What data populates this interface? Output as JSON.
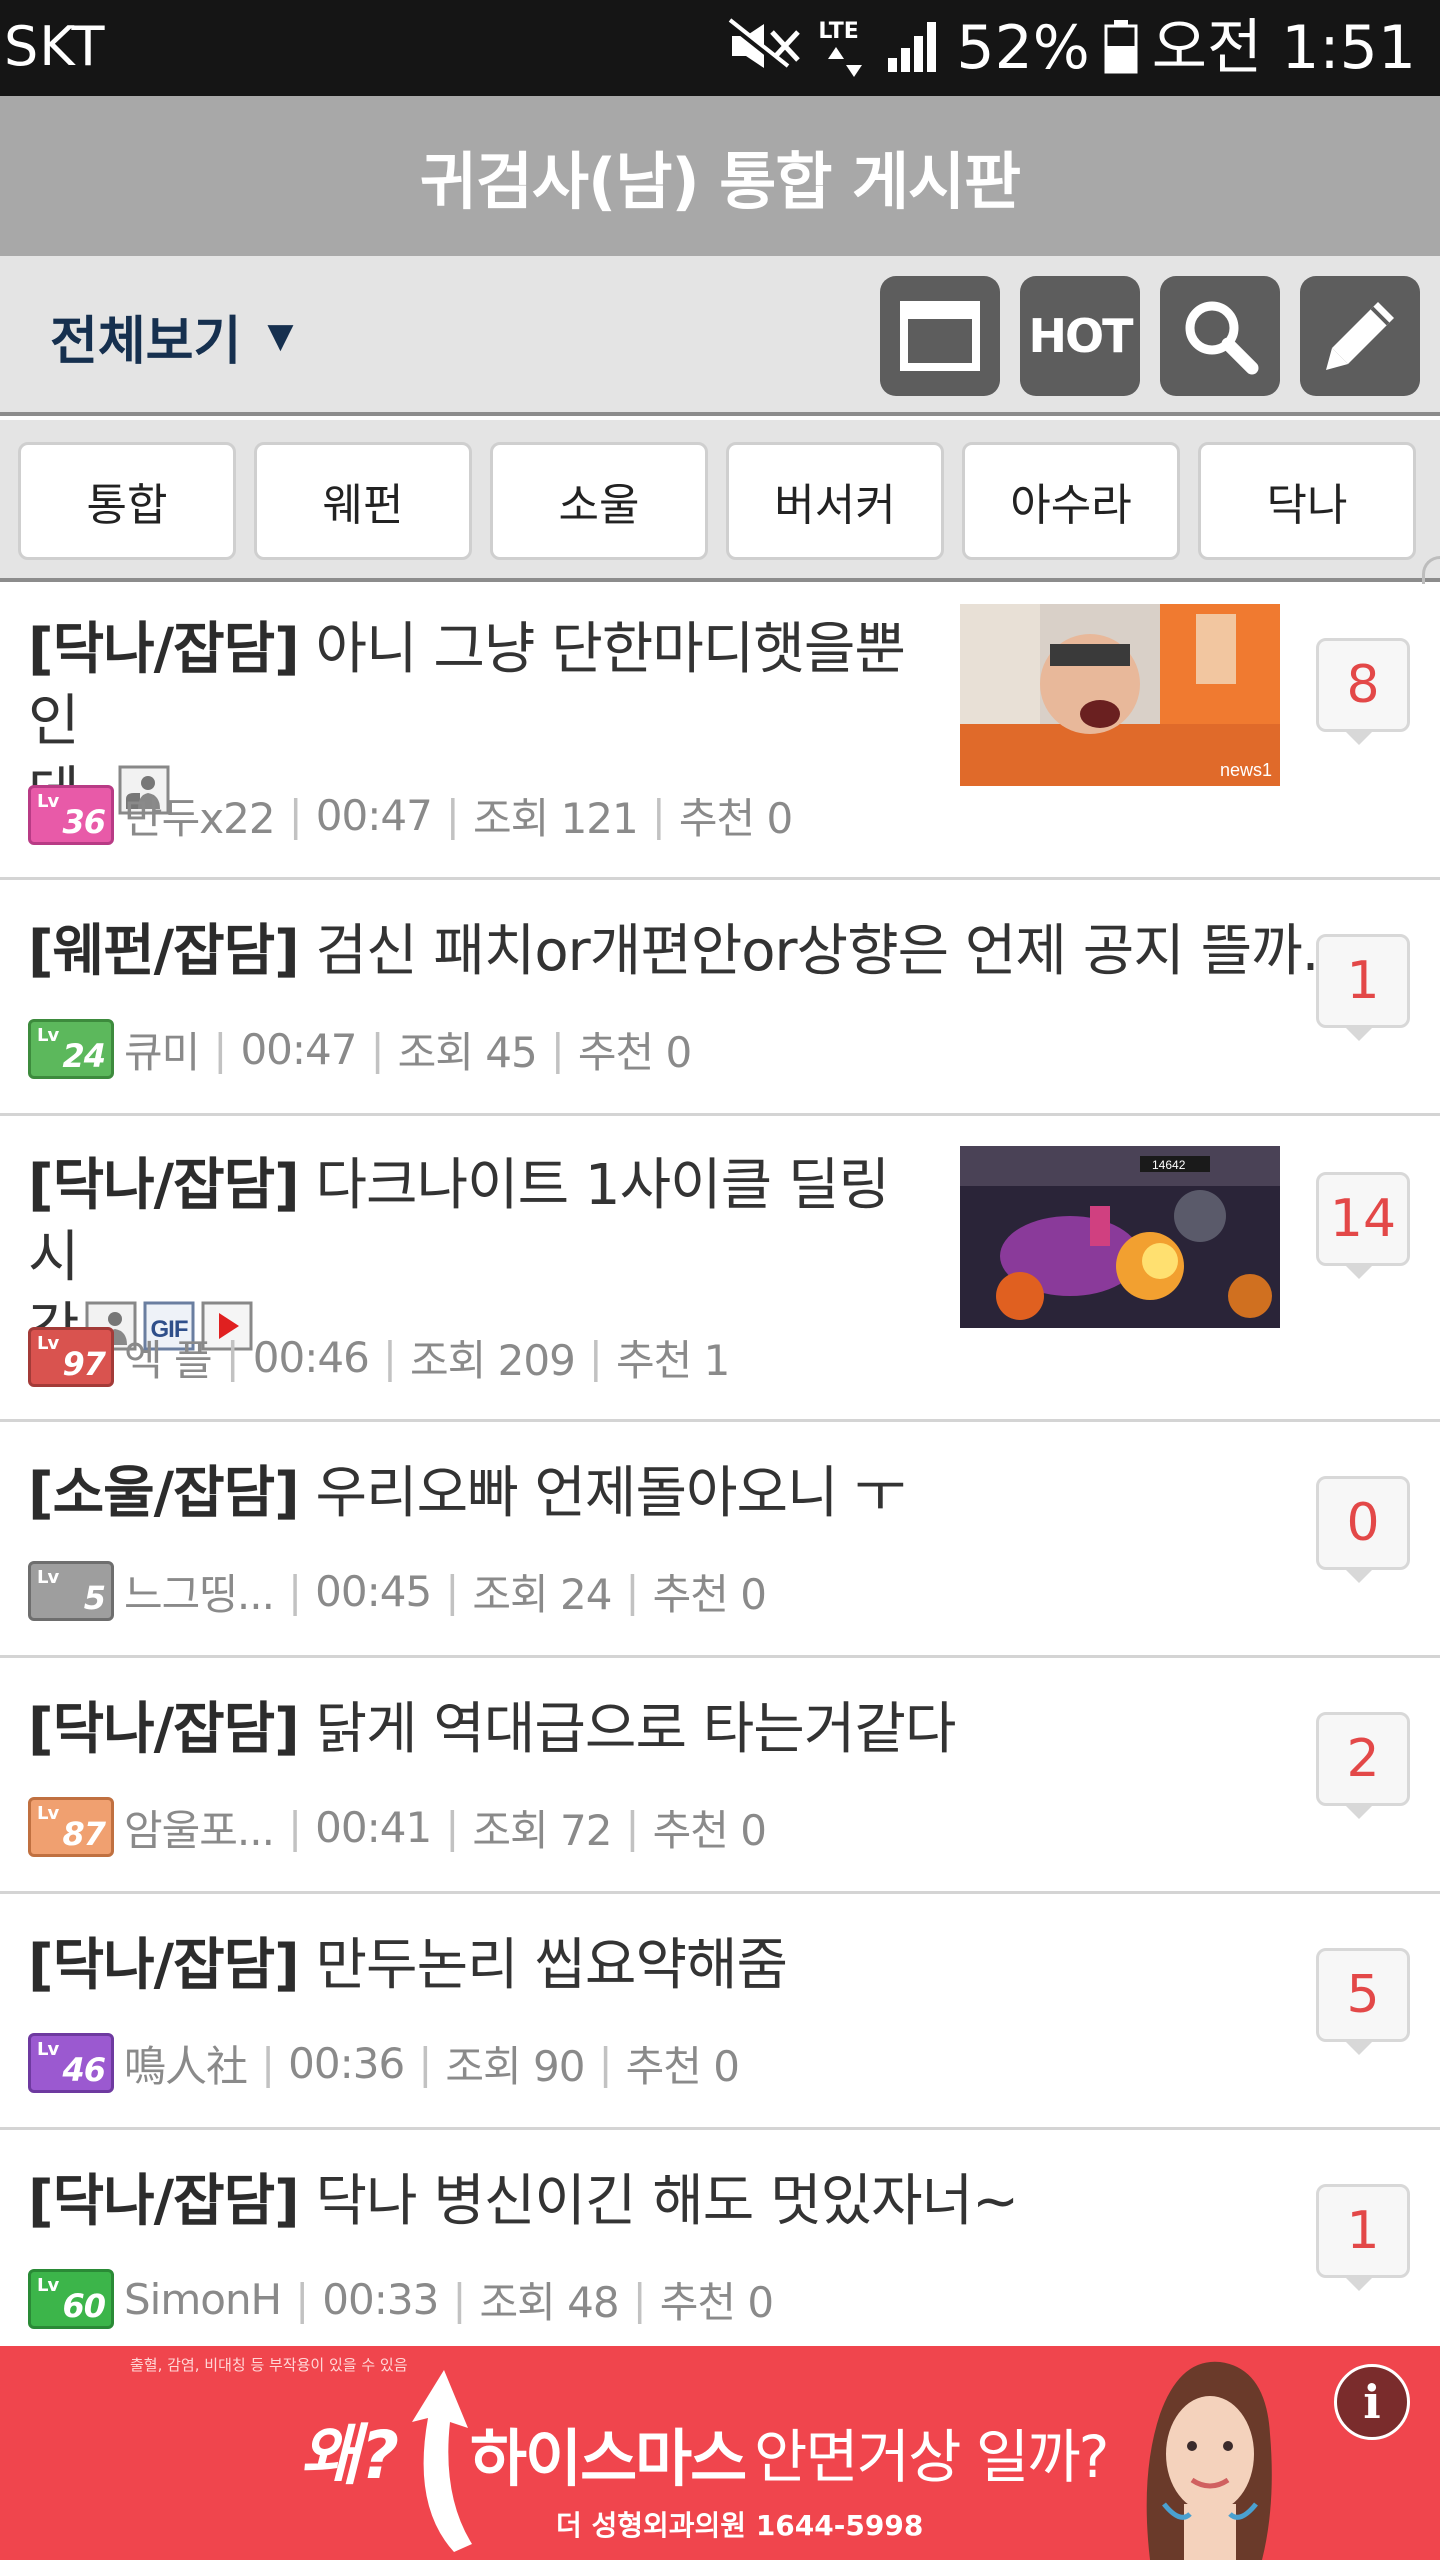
{
  "statusbar": {
    "carrier": "SKT",
    "network": "LTE",
    "battery": "52%",
    "time": "오전 1:51"
  },
  "header": {
    "title": "귀검사(남) 통합 게시판"
  },
  "toolbar": {
    "view_label": "전체보기",
    "view_caret": "▼",
    "hot_label": "HOT",
    "icons": [
      "window-icon",
      "hot-icon",
      "search-icon",
      "pencil-icon"
    ]
  },
  "tabs": [
    "통합",
    "웨펀",
    "소울",
    "버서커",
    "아수라",
    "닥나"
  ],
  "posts": [
    {
      "category": "[닥나/잡담]",
      "title_l1": " 아니 그냥 단한마디햇을뿐인",
      "title_l2": "데..",
      "level": "36",
      "level_color": "#e85aa8",
      "author": "만두x22",
      "time": "00:47",
      "views": "조회 121",
      "recommends": "추천 0",
      "comments": "8",
      "thumbnail": "photo"
    },
    {
      "category": "[웨펀/잡담]",
      "title_l1": " 검신 패치or개편안or상향은 언제 공지 뜰까...",
      "level": "24",
      "level_color": "#5cb85c",
      "author": "큐미",
      "time": "00:47",
      "views": "조회 45",
      "recommends": "추천 0",
      "comments": "1"
    },
    {
      "category": "[닥나/잡담]",
      "title_l1": " 다크나이트 1사이클 딜링시",
      "title_l2": "간",
      "level": "97",
      "level_color": "#d9534f",
      "author": "엑 플",
      "time": "00:46",
      "views": "조회 209",
      "recommends": "추천 1",
      "comments": "14",
      "thumbnail": "game"
    },
    {
      "category": "[소울/잡담]",
      "title_l1": " 우리오빠 언제돌아오니 ㅜ",
      "level": "5",
      "level_color": "#9e9e9e",
      "author": "느그띵...",
      "time": "00:45",
      "views": "조회 24",
      "recommends": "추천 0",
      "comments": "0"
    },
    {
      "category": "[닥나/잡담]",
      "title_l1": " 닭게 역대급으로 타는거같다",
      "level": "87",
      "level_color": "#f0a070",
      "author": "암울포...",
      "time": "00:41",
      "views": "조회 72",
      "recommends": "추천 0",
      "comments": "2"
    },
    {
      "category": "[닥나/잡담]",
      "title_l1": " 만두논리 씹요약해줌",
      "level": "46",
      "level_color": "#9b59d0",
      "author": "鳴人社",
      "time": "00:36",
      "views": "조회 90",
      "recommends": "추천 0",
      "comments": "5"
    },
    {
      "category": "[닥나/잡담]",
      "title_l1": " 닥나 병신이긴 해도 멋있자너~",
      "level": "60",
      "level_color": "#3cb54a",
      "author": "SimonH",
      "time": "00:33",
      "views": "조회 48",
      "recommends": "추천 0",
      "comments": "1"
    }
  ],
  "ad": {
    "small_text": "출혈, 감염, 비대칭 등 부작용이 있을 수 있음",
    "why": "왜?",
    "brand": "하이스마스",
    "question": "안면거상 일까?",
    "clinic": "더 성형외과의원 1644-5998",
    "info": "i"
  },
  "colors": {
    "accent": "#e34848",
    "header_bg": "#a8a8a8",
    "toolbar_bg": "#e4e4e4",
    "ad_bg": "#f0454d"
  }
}
